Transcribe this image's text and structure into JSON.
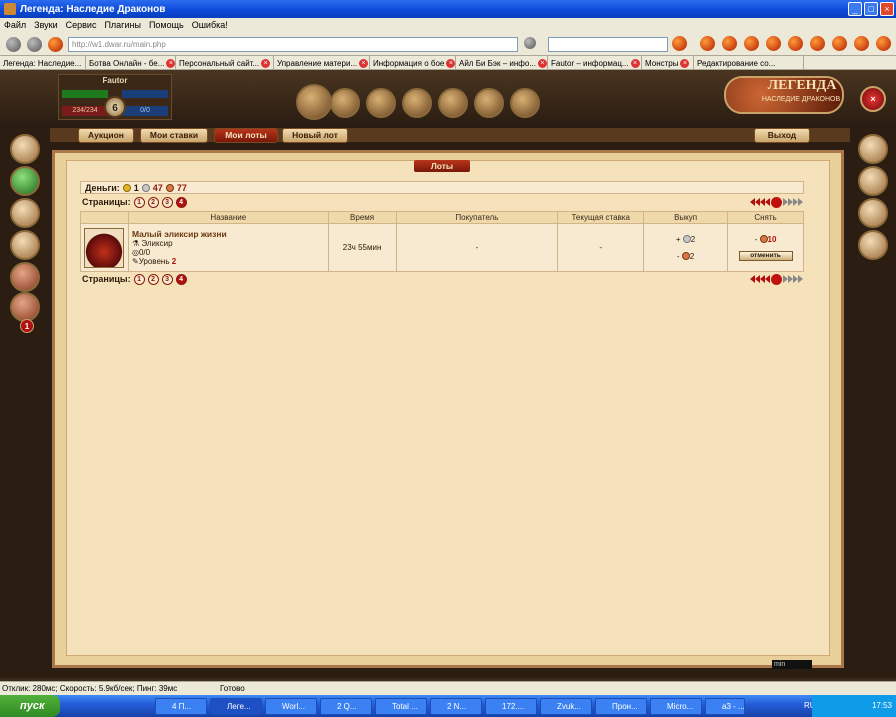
{
  "window": {
    "title": "Легенда: Наследие Драконов"
  },
  "menu": [
    "Файл",
    "Звуки",
    "Сервис",
    "Плагины",
    "Помощь",
    "Ошибка!"
  ],
  "address": {
    "url": "http://w1.dwar.ru/main.php"
  },
  "tabs": [
    "Легенда: Наследие...",
    "Ботва Онлайн - бе...",
    "Персональный сайт...",
    "Управление матери...",
    "Информация о бое",
    "Айл Би Бэк – инфо...",
    "Fautor – информац...",
    "Монстры",
    "Редактирование со..."
  ],
  "player": {
    "name": "Fautor",
    "level": "6",
    "hp": "234/234",
    "mp": "0/0"
  },
  "logo": {
    "title": "ЛЕГЕНДА",
    "subtitle": "НАСЛЕДИЕ ДРАКОНОВ"
  },
  "notifications": "1",
  "nav": {
    "auction": "Аукцион",
    "my_bids": "Мои ставки",
    "my_lots": "Мои лоты",
    "new_lot": "Новый лот",
    "exit": "Выход"
  },
  "lots": {
    "title": "Лоты",
    "money_label": "Деньги:",
    "gold": "1",
    "silver": "47",
    "copper": "77",
    "pages_label": "Страницы:",
    "pages": [
      "1",
      "2",
      "3",
      "4"
    ],
    "current_page": "4",
    "columns": [
      "Название",
      "Время",
      "Покупатель",
      "Текущая ставка",
      "Выкуп",
      "Снять"
    ],
    "rows": [
      {
        "name": "Малый эликсир жизни",
        "type": "Эликсир",
        "durability": "0/0",
        "level_label": "Уровень",
        "level": "2",
        "time": "23ч 55мин",
        "buyer": "-",
        "bid": "-",
        "buyout_plus": "+",
        "buyout_plus_val": "2",
        "buyout_minus": "-",
        "buyout_minus_val": "2",
        "remove_sign": "-",
        "remove_val": "10",
        "cancel_label": "отменить"
      }
    ]
  },
  "corner_label": "min",
  "status": {
    "text": "Отклик: 280мс; Скорость: 5.9кб/сек; Пинг: 39мс",
    "ready": "Готово"
  },
  "taskbar": {
    "start": "пуск",
    "items": [
      "4 П...",
      "Леге...",
      "Worl...",
      "2 Q...",
      "Total ...",
      "2 N...",
      "172....",
      "Zvuk...",
      "Прон...",
      "Micro...",
      "a3 - ..."
    ],
    "lang": "RU",
    "time": "17:53"
  }
}
